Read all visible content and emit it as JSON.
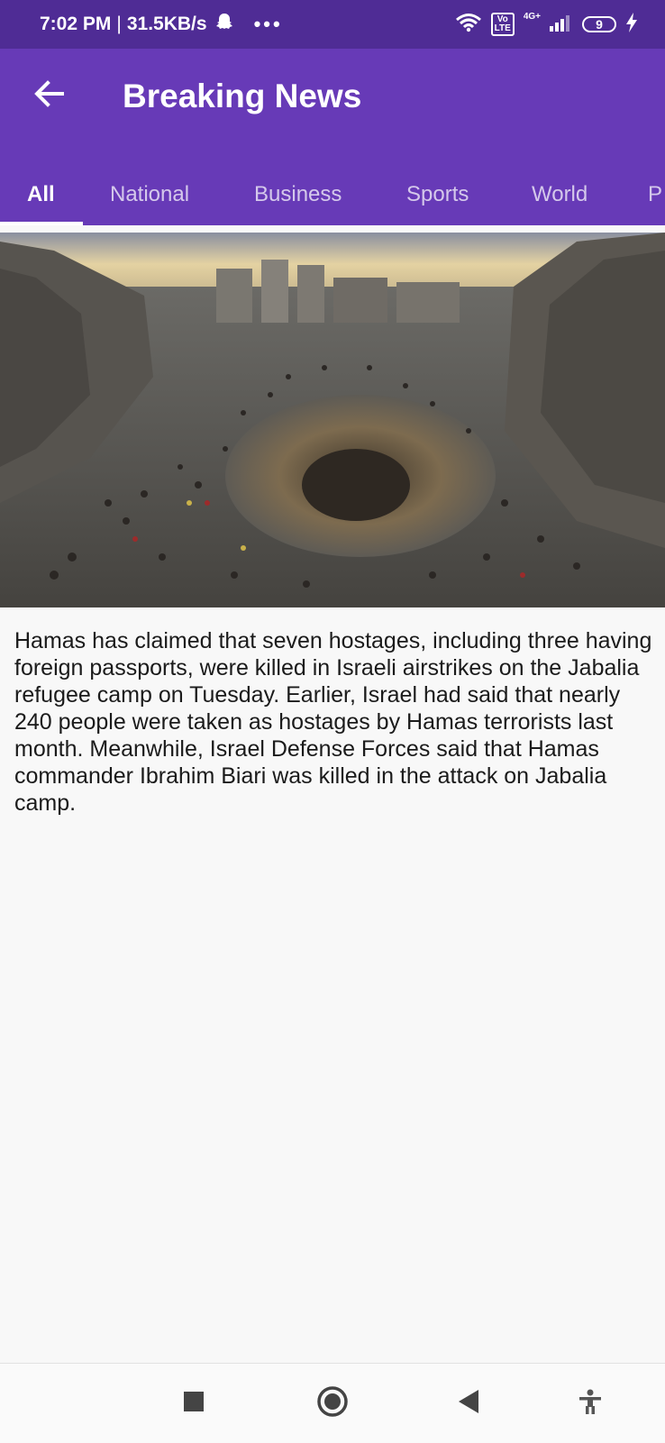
{
  "status_bar": {
    "time": "7:02 PM",
    "separator": "|",
    "speed": "31.5KB/s",
    "dots": "•••",
    "network_type": "4G+",
    "volte_top": "Vo",
    "volte_bottom": "LTE",
    "battery": "9",
    "icons": [
      "snapchat-ghost-icon",
      "wifi-icon",
      "volte-icon",
      "signal-icon",
      "battery-icon",
      "charging-icon"
    ]
  },
  "app_bar": {
    "title": "Breaking News",
    "back_icon": "arrow-left-icon"
  },
  "tabs": [
    {
      "label": "All",
      "active": true
    },
    {
      "label": "National",
      "active": false
    },
    {
      "label": "Business",
      "active": false
    },
    {
      "label": "Sports",
      "active": false
    },
    {
      "label": "World",
      "active": false
    },
    {
      "label": "P",
      "active": false
    }
  ],
  "article": {
    "image_icon": "news-photo",
    "text": "Hamas has claimed that seven hostages, including three having foreign passports, were killed in Israeli airstrikes on the Jabalia refugee camp on Tuesday. Earlier, Israel had said that nearly 240 people were taken as hostages by Hamas terrorists last month. Meanwhile, Israel Defense Forces said that Hamas commander Ibrahim Biari was killed in the attack on Jabalia camp."
  },
  "nav_bar": {
    "icons": [
      "recents-square-icon",
      "home-circle-icon",
      "back-triangle-icon",
      "accessibility-icon"
    ]
  },
  "colors": {
    "status_bar": "#4f2c95",
    "app_bar": "#673ab7",
    "background": "#f8f8f8"
  }
}
